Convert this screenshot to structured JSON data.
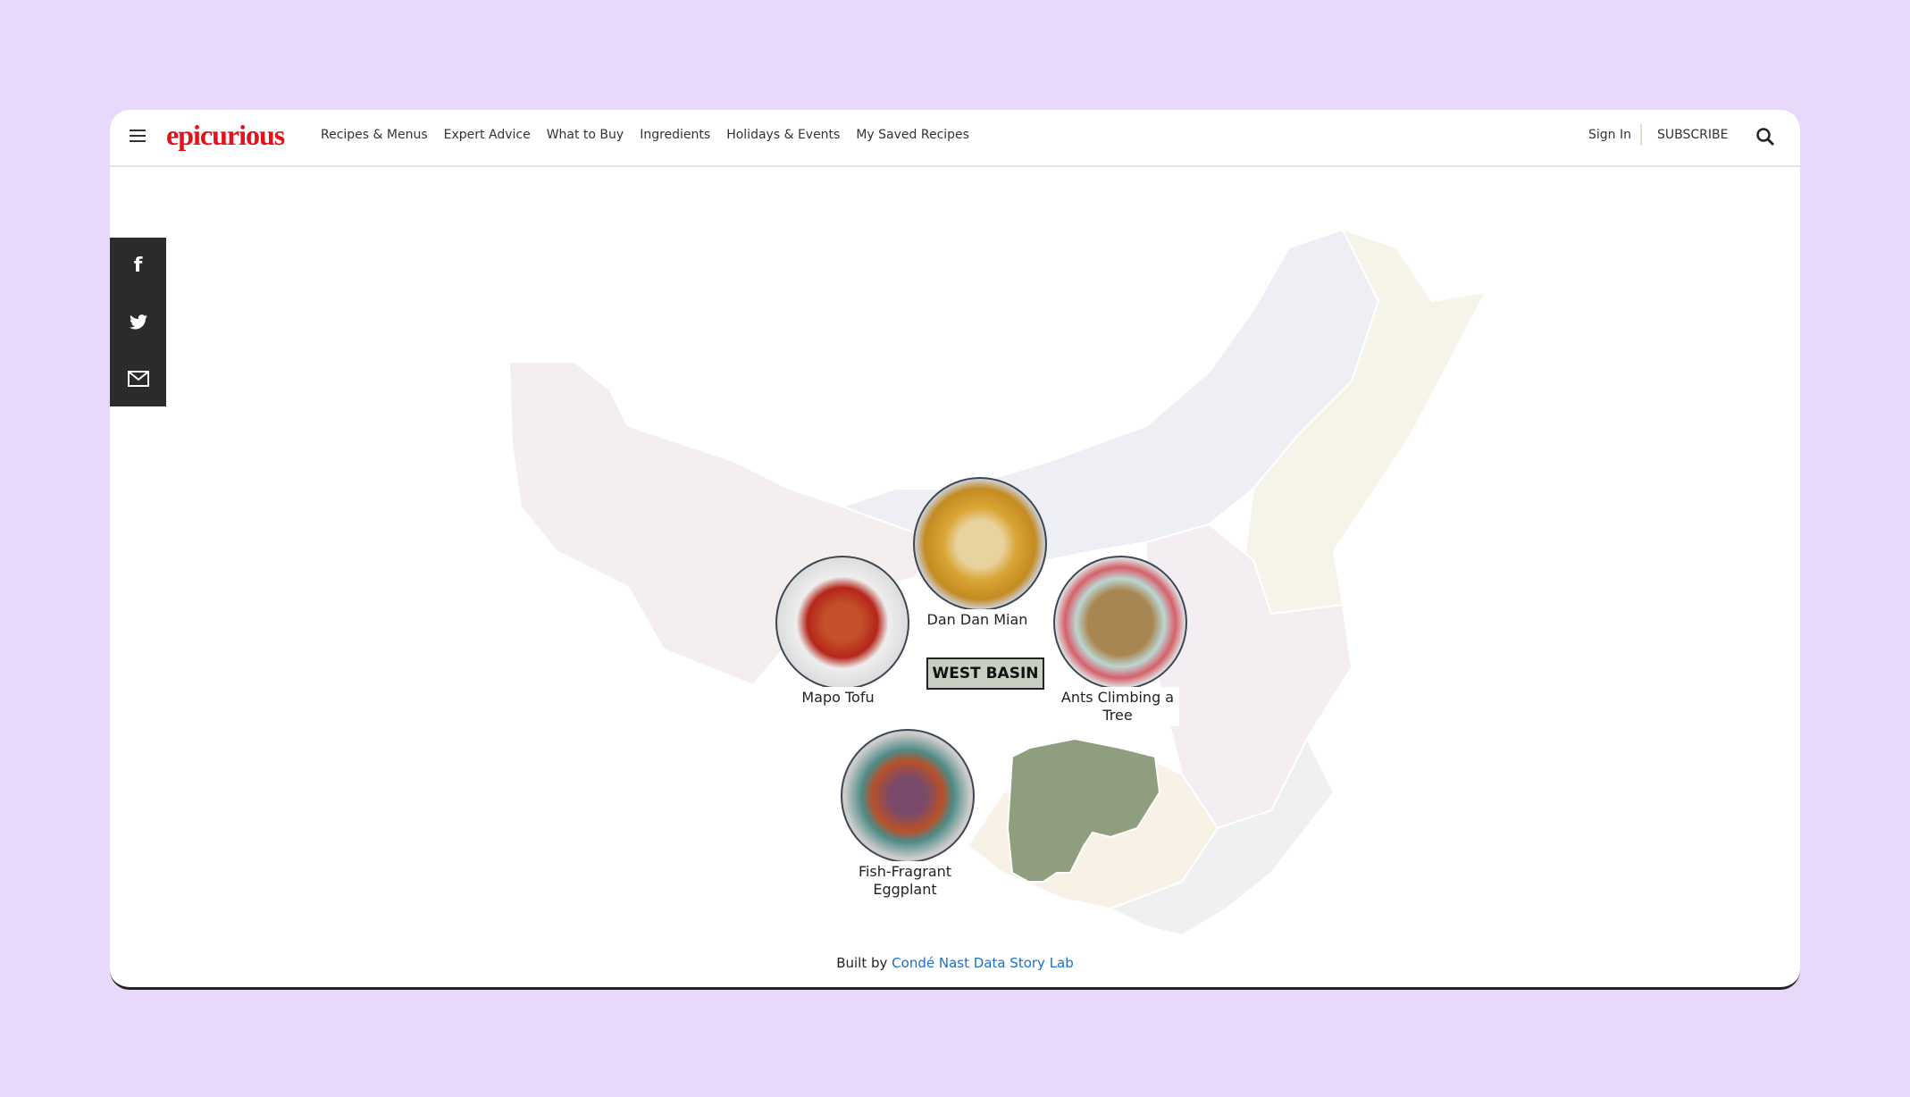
{
  "header": {
    "logo": "epicurious",
    "nav": [
      "Recipes & Menus",
      "Expert Advice",
      "What to Buy",
      "Ingredients",
      "Holidays & Events",
      "My Saved Recipes"
    ],
    "sign_in": "Sign In",
    "subscribe": "SUBSCRIBE"
  },
  "social": [
    "facebook-icon",
    "twitter-icon",
    "email-icon"
  ],
  "map": {
    "region_label": "WEST BASIN",
    "region_color": "#8f9e7e",
    "dishes": [
      {
        "name": "Dan Dan Mian",
        "color": "#d9a534"
      },
      {
        "name": "Mapo Tofu",
        "color": "#b5261a"
      },
      {
        "name": "Ants Climbing a Tree",
        "color": "#a88651"
      },
      {
        "name": "Fish-Fragrant Eggplant",
        "color": "#7a4a6a"
      }
    ]
  },
  "footer": {
    "prefix": "Built by",
    "link": "Condé Nast Data Story Lab"
  }
}
